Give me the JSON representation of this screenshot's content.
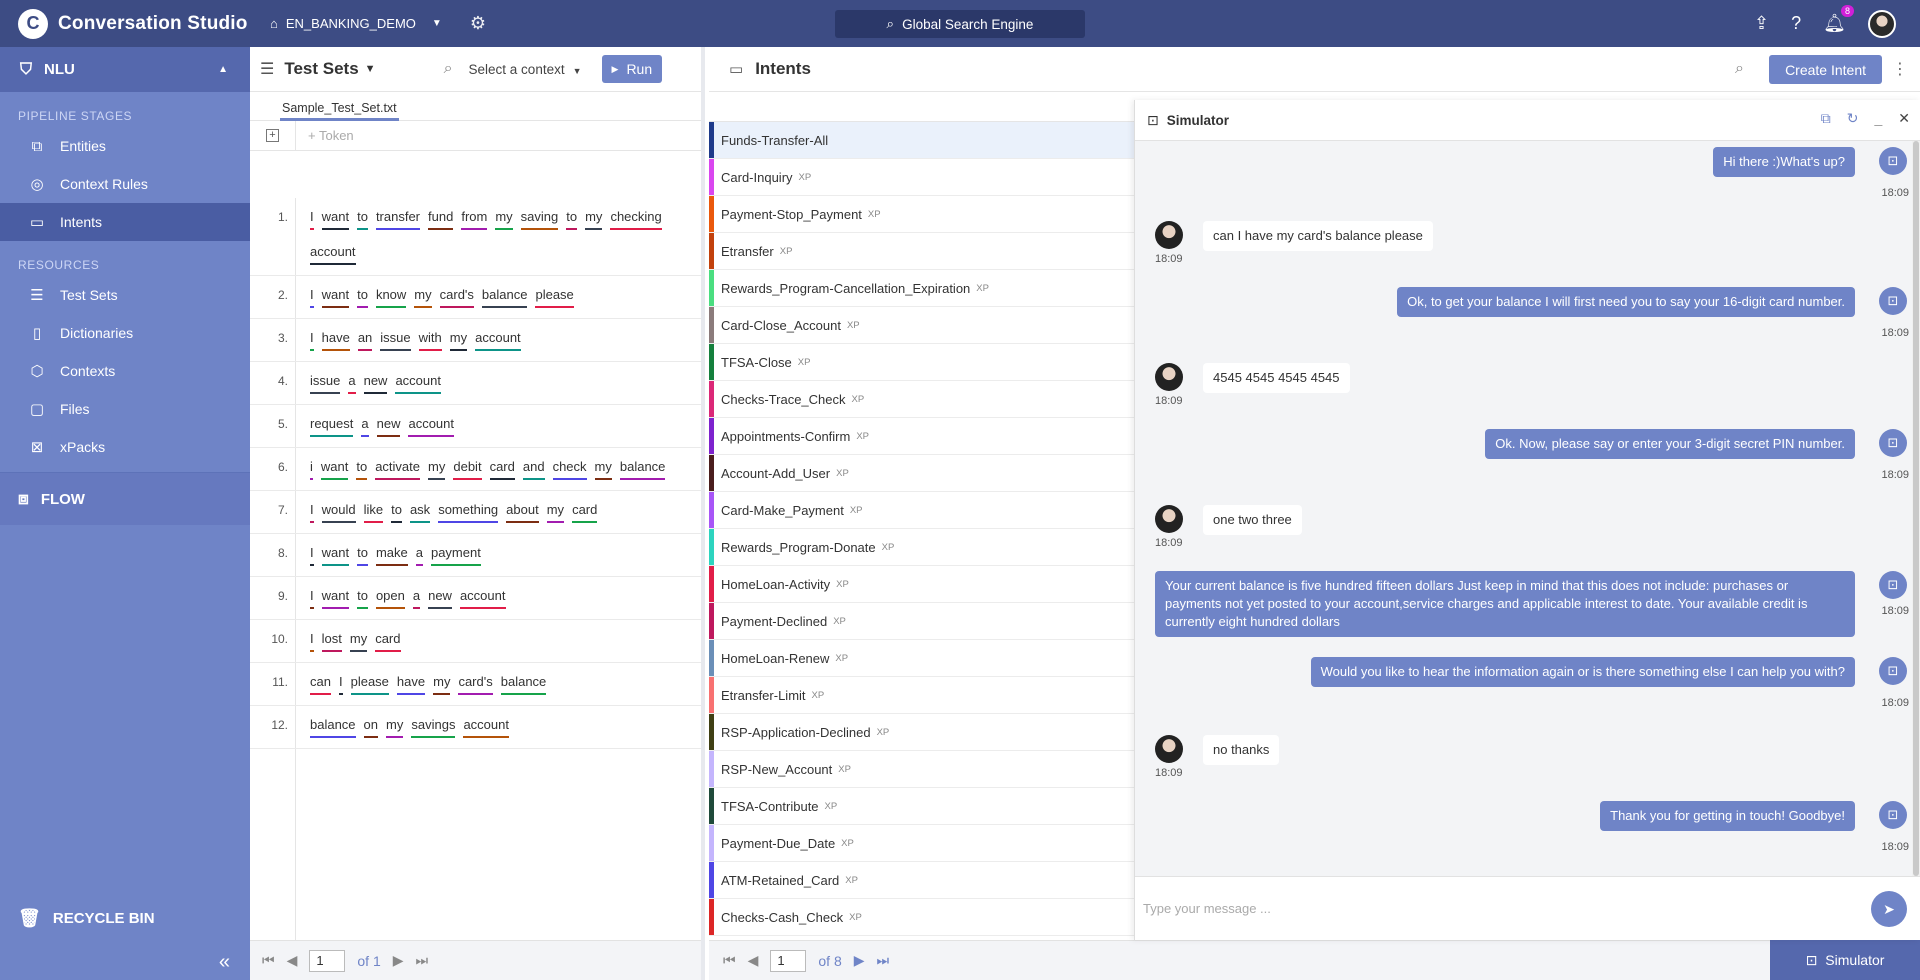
{
  "app": {
    "title": "Conversation Studio",
    "logo_letter": "C"
  },
  "header": {
    "project": "EN_BANKING_DEMO",
    "search": "Global Search Engine",
    "notifications": "8"
  },
  "sidebar": {
    "nlu": "NLU",
    "pipeline_section": "PIPELINE STAGES",
    "pipeline": [
      {
        "label": "Entities",
        "icon": "puzzle-icon"
      },
      {
        "label": "Context Rules",
        "icon": "bulb-icon"
      },
      {
        "label": "Intents",
        "icon": "chat-icon"
      }
    ],
    "resources_section": "RESOURCES",
    "resources": [
      {
        "label": "Test Sets",
        "icon": "list-icon"
      },
      {
        "label": "Dictionaries",
        "icon": "book-icon"
      },
      {
        "label": "Contexts",
        "icon": "context-icon"
      },
      {
        "label": "Files",
        "icon": "file-icon"
      },
      {
        "label": "xPacks",
        "icon": "xpack-icon"
      }
    ],
    "flow": "FLOW",
    "recycle": "RECYCLE BIN"
  },
  "testsets": {
    "title": "Test Sets",
    "context_select": "Select a context",
    "run": "Run",
    "tab": "Sample_Test_Set.txt",
    "token_placeholder": "+ Token",
    "rows": [
      {
        "n": "1.",
        "tokens": [
          "I",
          "want",
          "to",
          "transfer",
          "fund",
          "from",
          "my",
          "saving",
          "to",
          "my",
          "checking",
          "account"
        ]
      },
      {
        "n": "2.",
        "tokens": [
          "I",
          "want",
          "to",
          "know",
          "my",
          "card's",
          "balance",
          "please"
        ]
      },
      {
        "n": "3.",
        "tokens": [
          "I",
          "have",
          "an",
          "issue",
          "with",
          "my",
          "account"
        ]
      },
      {
        "n": "4.",
        "tokens": [
          "issue",
          "a",
          "new",
          "account"
        ]
      },
      {
        "n": "5.",
        "tokens": [
          "request",
          "a",
          "new",
          "account"
        ]
      },
      {
        "n": "6.",
        "tokens": [
          "i",
          "want",
          "to",
          "activate",
          "my",
          "debit",
          "card",
          "and",
          "check",
          "my",
          "balance"
        ]
      },
      {
        "n": "7.",
        "tokens": [
          "I",
          "would",
          "like",
          "to",
          "ask",
          "something",
          "about",
          "my",
          "card"
        ]
      },
      {
        "n": "8.",
        "tokens": [
          "I",
          "want",
          "to",
          "make",
          "a",
          "payment"
        ]
      },
      {
        "n": "9.",
        "tokens": [
          "I",
          "want",
          "to",
          "open",
          "a",
          "new",
          "account"
        ]
      },
      {
        "n": "10.",
        "tokens": [
          "I",
          "lost",
          "my",
          "card"
        ]
      },
      {
        "n": "11.",
        "tokens": [
          "can",
          "I",
          "please",
          "have",
          "my",
          "card's",
          "balance"
        ]
      },
      {
        "n": "12.",
        "tokens": [
          "balance",
          "on",
          "my",
          "savings",
          "account"
        ]
      }
    ],
    "page": "1",
    "of": "of 1"
  },
  "intents": {
    "title": "Intents",
    "create": "Create Intent",
    "page": "1",
    "of": "of 8",
    "xp": "XP",
    "items": [
      {
        "name": "Funds-Transfer-All",
        "xp": false,
        "color": "#1e3a8a"
      },
      {
        "name": "Card-Inquiry",
        "xp": true,
        "color": "#d946ef"
      },
      {
        "name": "Payment-Stop_Payment",
        "xp": true,
        "color": "#ea580c"
      },
      {
        "name": "Etransfer",
        "xp": true,
        "color": "#c2410c"
      },
      {
        "name": "Rewards_Program-Cancellation_Expiration",
        "xp": true,
        "color": "#4ade80"
      },
      {
        "name": "Card-Close_Account",
        "xp": true,
        "color": "#8b7b7b"
      },
      {
        "name": "TFSA-Close",
        "xp": true,
        "color": "#15803d"
      },
      {
        "name": "Checks-Trace_Check",
        "xp": true,
        "color": "#db2777"
      },
      {
        "name": "Appointments-Confirm",
        "xp": true,
        "color": "#7e22ce"
      },
      {
        "name": "Account-Add_User",
        "xp": true,
        "color": "#4a1d1d"
      },
      {
        "name": "Card-Make_Payment",
        "xp": true,
        "color": "#a855f7"
      },
      {
        "name": "Rewards_Program-Donate",
        "xp": true,
        "color": "#2dd4bf"
      },
      {
        "name": "HomeLoan-Activity",
        "xp": true,
        "color": "#e11d48"
      },
      {
        "name": "Payment-Declined",
        "xp": true,
        "color": "#be185d"
      },
      {
        "name": "HomeLoan-Renew",
        "xp": true,
        "color": "#6b8fb8"
      },
      {
        "name": "Etransfer-Limit",
        "xp": true,
        "color": "#f87171"
      },
      {
        "name": "RSP-Application-Declined",
        "xp": true,
        "color": "#3f3f14"
      },
      {
        "name": "RSP-New_Account",
        "xp": true,
        "color": "#c4b5fd"
      },
      {
        "name": "TFSA-Contribute",
        "xp": true,
        "color": "#1f4a3a"
      },
      {
        "name": "Payment-Due_Date",
        "xp": true,
        "color": "#c4b5fd"
      },
      {
        "name": "ATM-Retained_Card",
        "xp": true,
        "color": "#4f46e5"
      },
      {
        "name": "Checks-Cash_Check",
        "xp": true,
        "color": "#dc2626"
      }
    ]
  },
  "simulator": {
    "title": "Simulator",
    "input_placeholder": "Type your message ...",
    "button": "Simulator",
    "messages": [
      {
        "from": "bot",
        "text": "Hi there :)What's up?",
        "time": "18:09"
      },
      {
        "from": "user",
        "text": "can I have my card's balance please",
        "time": "18:09"
      },
      {
        "from": "bot",
        "text": "Ok, to get your balance I will first need you to say your 16-digit card number.",
        "time": "18:09"
      },
      {
        "from": "user",
        "text": "4545 4545 4545 4545",
        "time": "18:09"
      },
      {
        "from": "bot",
        "text": "Ok. Now, please say or enter your 3-digit secret PIN number.",
        "time": "18:09"
      },
      {
        "from": "user",
        "text": "one two three",
        "time": "18:09"
      },
      {
        "from": "bot",
        "text": "Your current balance is five hundred fifteen dollars Just keep in mind that this does not include: purchases or payments not yet posted to your account,service charges and applicable interest to date. Your available credit is currently eight hundred dollars",
        "time": "18:09"
      },
      {
        "from": "bot",
        "text": "Would you like to hear the information again or is there something else I can help you with?",
        "time": "18:09"
      },
      {
        "from": "user",
        "text": "no thanks",
        "time": "18:09"
      },
      {
        "from": "bot",
        "text": "Thank you for getting in touch! Goodbye!",
        "time": "18:09"
      }
    ]
  },
  "colors": {
    "accent": "#6f84c7",
    "topbar": "#3d4c84",
    "sidebar": "#6f84c7"
  }
}
